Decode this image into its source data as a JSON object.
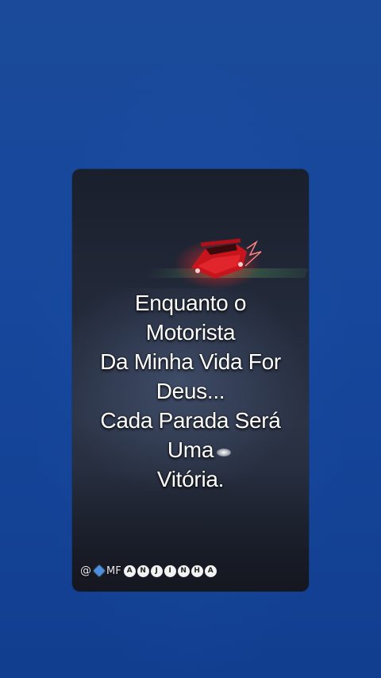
{
  "video": {
    "caption_lines": [
      "Enquanto o",
      "Motorista",
      "Da Minha Vida For",
      "Deus...",
      "Cada Parada Será",
      "Uma",
      "Vitória."
    ],
    "watermark": {
      "prefix": "@",
      "plain": "MF",
      "circled_letters": [
        "A",
        "N",
        "J",
        "I",
        "N",
        "H",
        "A"
      ]
    }
  },
  "colors": {
    "background": "#16479c",
    "caption_text": "#ffffff",
    "car_red": "#d91a22"
  },
  "icons": {
    "car": "red-car-icon",
    "diamond": "diamond-icon"
  }
}
